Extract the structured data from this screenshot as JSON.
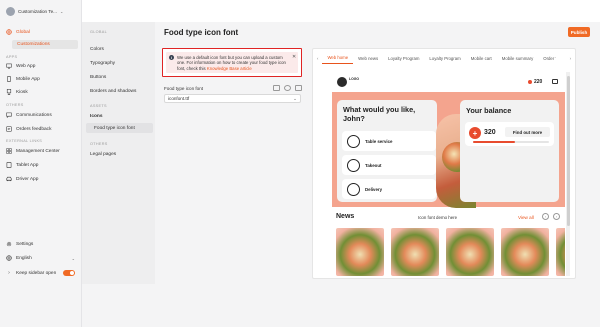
{
  "org": {
    "name": "Customization Te..."
  },
  "sidebar": {
    "items": [
      {
        "label": "Global",
        "icon": "globe-icon"
      },
      {
        "label": "Customizations"
      },
      {
        "section": "APPS"
      },
      {
        "label": "Web App",
        "icon": "monitor-icon"
      },
      {
        "label": "Mobile App",
        "icon": "phone-icon"
      },
      {
        "label": "Kiosk",
        "icon": "kiosk-icon"
      },
      {
        "section": "OTHERS"
      },
      {
        "label": "Communications",
        "icon": "chat-icon"
      },
      {
        "label": "Orders feedback",
        "icon": "feedback-icon"
      },
      {
        "section": "EXTERNAL LINKS"
      },
      {
        "label": "Management Center",
        "icon": "grid-icon"
      },
      {
        "label": "Tablet App",
        "icon": "tablet-icon"
      },
      {
        "label": "Driver App",
        "icon": "car-icon"
      }
    ],
    "footer": {
      "settings": "Settings",
      "language": "English",
      "keep_open": "Keep sidebar open"
    }
  },
  "subnav": {
    "section_global": "GLOBAL",
    "colors": "Colors",
    "typography": "Typography",
    "buttons": "Buttons",
    "borders": "Borders and shadows",
    "section_assets": "ASSETS",
    "icons": "Icons",
    "food_icon_font": "Food type icon font",
    "section_others": "OTHERS",
    "legal": "Legal pages"
  },
  "page": {
    "title": "Food type icon font",
    "publish": "Publish",
    "alert_text": "We use a default icon font but you can upload a custom one. For information on how to create your food type icon font, check this ",
    "alert_link": "Knowledge Base article",
    "field_label": "Food type icon font",
    "field_value": "iconfont.ttf"
  },
  "preview": {
    "tabs": [
      "Web home",
      "Web news",
      "Loyalty Program",
      "Loyalty Program",
      "Mobile cart",
      "Mobile summary",
      "Order Tab"
    ],
    "logo_text": "LOGO",
    "points": "220",
    "order_title": "What would you like, John?",
    "options": [
      "Table service",
      "Takeout",
      "Delivery"
    ],
    "balance_title": "Your balance",
    "balance_value": "320",
    "balance_button": "Find out more",
    "balance_fill": 0.55,
    "news_title": "News",
    "news_mid": "Icon font demo here",
    "view_all": "View all"
  },
  "colors": {
    "accent": "#f06a25",
    "alert_border": "#e02424",
    "hero": "#f4a48e"
  }
}
